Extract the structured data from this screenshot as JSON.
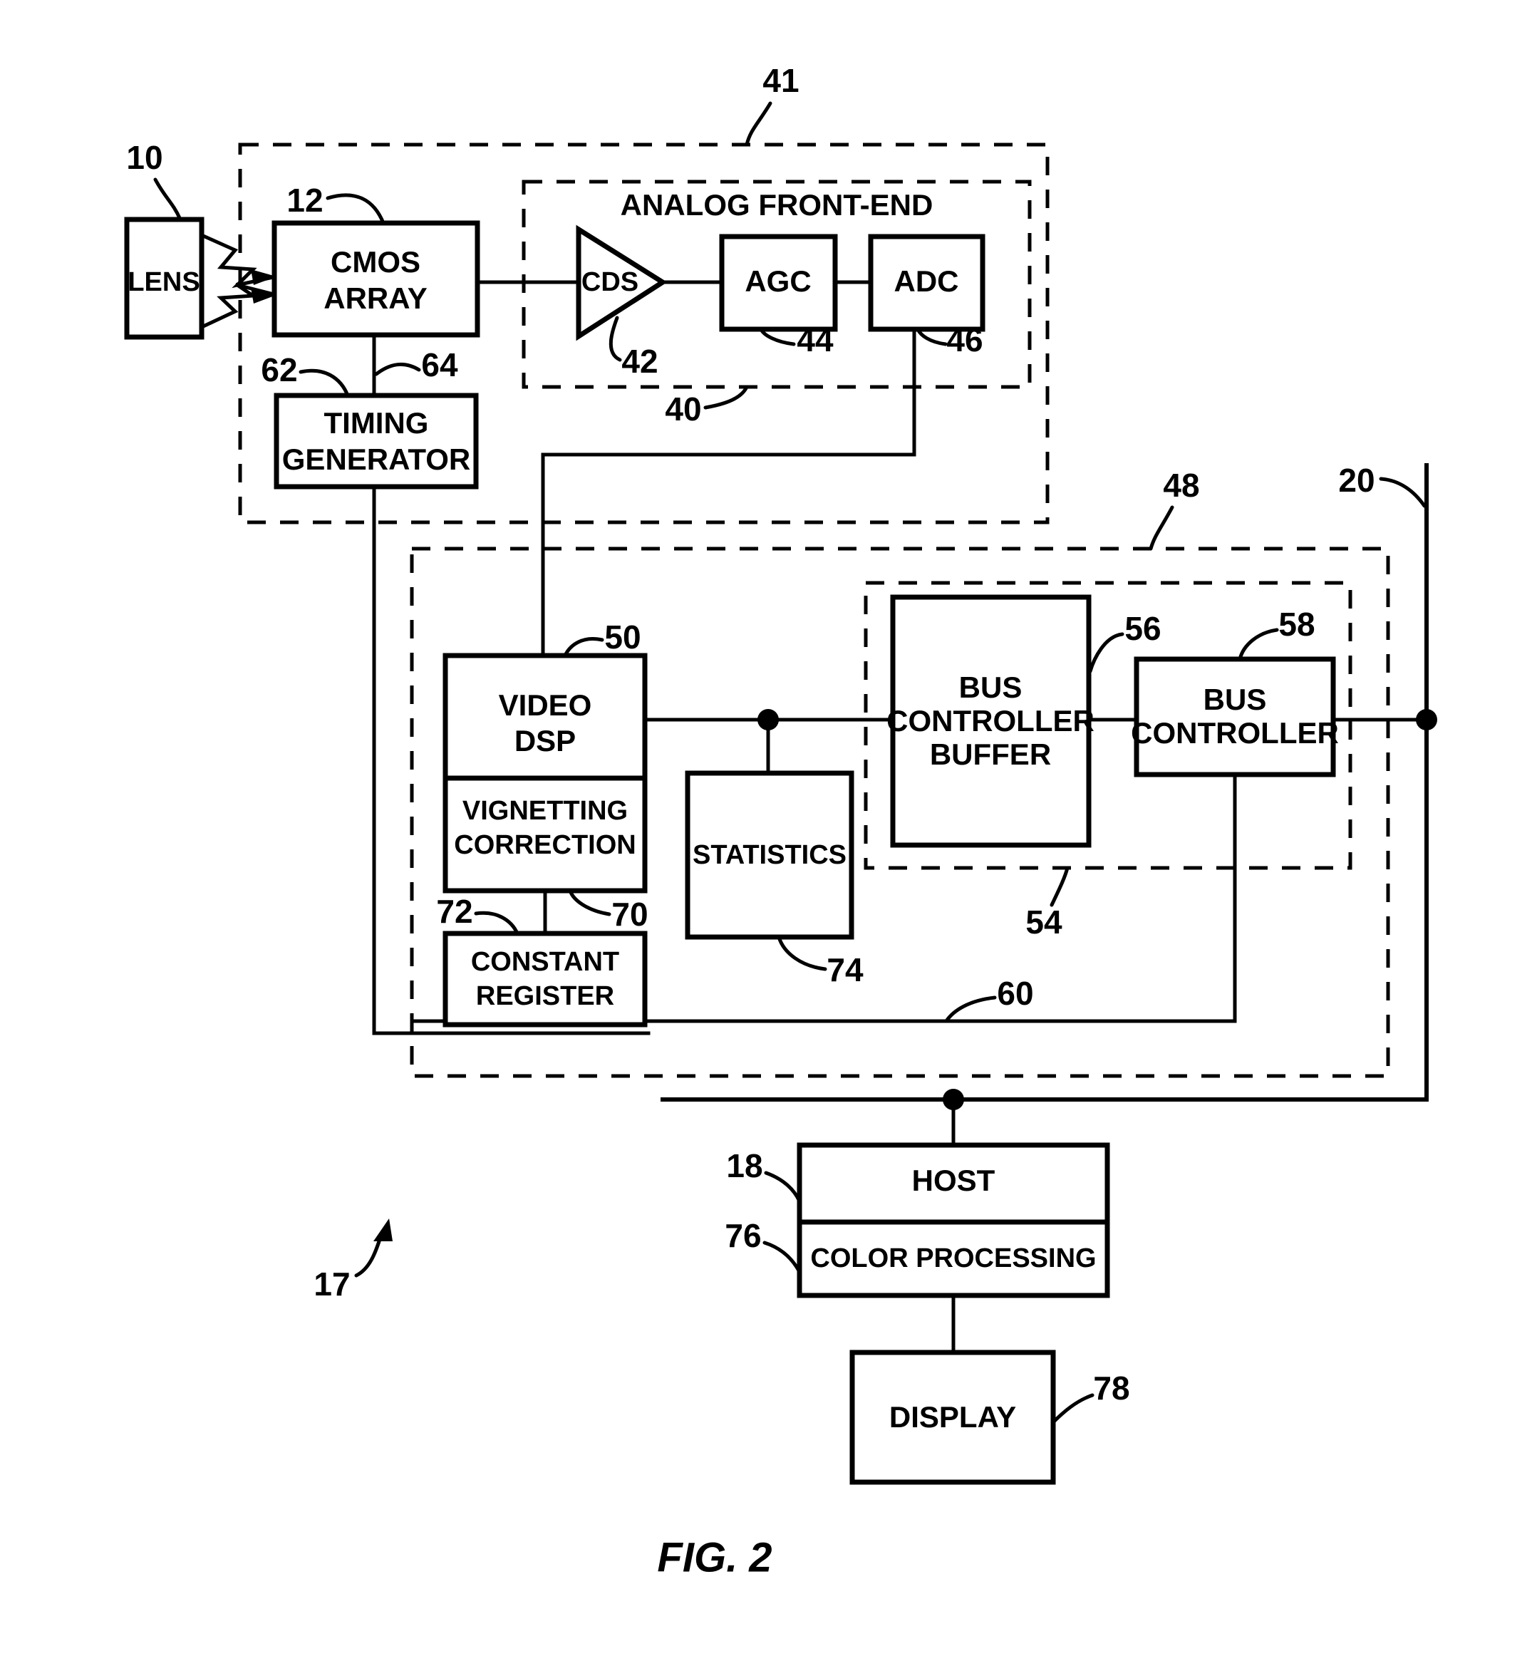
{
  "figure": {
    "caption": "FIG. 2",
    "system_ref": "17"
  },
  "blocks": {
    "lens": {
      "label": "LENS",
      "ref": "10"
    },
    "cmos_array": {
      "label_line1": "CMOS",
      "label_line2": "ARRAY",
      "ref": "12"
    },
    "timing_generator": {
      "label_line1": "TIMING",
      "label_line2": "GENERATOR",
      "ref": "62"
    },
    "cds": {
      "label": "CDS",
      "ref": "42"
    },
    "agc": {
      "label": "AGC",
      "ref": "44"
    },
    "adc": {
      "label": "ADC",
      "ref": "46"
    },
    "video_dsp": {
      "label_line1": "VIDEO",
      "label_line2": "DSP",
      "ref": "50"
    },
    "vignetting_correction": {
      "label_line1": "VIGNETTING",
      "label_line2": "CORRECTION",
      "ref": "70"
    },
    "constant_register": {
      "label_line1": "CONSTANT",
      "label_line2": "REGISTER",
      "ref": "72"
    },
    "statistics": {
      "label": "STATISTICS",
      "ref": "74"
    },
    "bus_controller_buffer": {
      "label_line1": "BUS",
      "label_line2": "CONTROLLER",
      "label_line3": "BUFFER",
      "ref": "56"
    },
    "bus_controller": {
      "label_line1": "BUS",
      "label_line2": "CONTROLLER",
      "ref": "58"
    },
    "host": {
      "label": "HOST",
      "ref": "18"
    },
    "color_processing": {
      "label": "COLOR PROCESSING",
      "ref": "76"
    },
    "display": {
      "label": "DISPLAY",
      "ref": "78"
    }
  },
  "groups": {
    "sensor_module": {
      "ref": "41"
    },
    "analog_front_end": {
      "title": "ANALOG FRONT-END",
      "ref": "40"
    },
    "processor_module": {
      "ref": "48"
    },
    "bus_group": {
      "ref": "54"
    },
    "internal_bus": {
      "ref": "60"
    },
    "cmos_clock_line": {
      "ref": "64"
    },
    "external_bus": {
      "ref": "20"
    }
  },
  "colors": {
    "line": "#000000",
    "background": "#ffffff"
  }
}
